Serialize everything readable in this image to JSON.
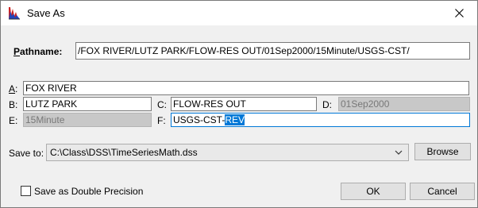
{
  "window": {
    "title": "Save As"
  },
  "pathname": {
    "label_first": "P",
    "label_rest": "athname:",
    "value": "/FOX RIVER/LUTZ PARK/FLOW-RES OUT/01Sep2000/15Minute/USGS-CST/"
  },
  "parts": {
    "a": {
      "label_first": "A",
      "label_rest": ":",
      "value": "FOX RIVER"
    },
    "b": {
      "label": "B:",
      "value": "LUTZ PARK"
    },
    "c": {
      "label": "C:",
      "value": "FLOW-RES OUT"
    },
    "d": {
      "label": "D:",
      "value": "01Sep2000"
    },
    "e": {
      "label": "E:",
      "value": "15Minute"
    },
    "f": {
      "label": "F:",
      "value_plain": "USGS-CST-",
      "value_selected": "REV"
    }
  },
  "save_to": {
    "label": "Save to:",
    "value": "C:\\Class\\DSS\\TimeSeriesMath.dss",
    "browse_label": "Browse"
  },
  "options": {
    "double_precision_label": "Save as Double Precision",
    "double_precision_checked": false
  },
  "buttons": {
    "ok": "OK",
    "cancel": "Cancel"
  },
  "icons": {
    "app": "hec-dssvue-chart-icon",
    "close": "close-icon",
    "dropdown": "chevron-down-icon"
  },
  "colors": {
    "accent": "#0078d7",
    "disabled_field": "#c8c8c8"
  }
}
